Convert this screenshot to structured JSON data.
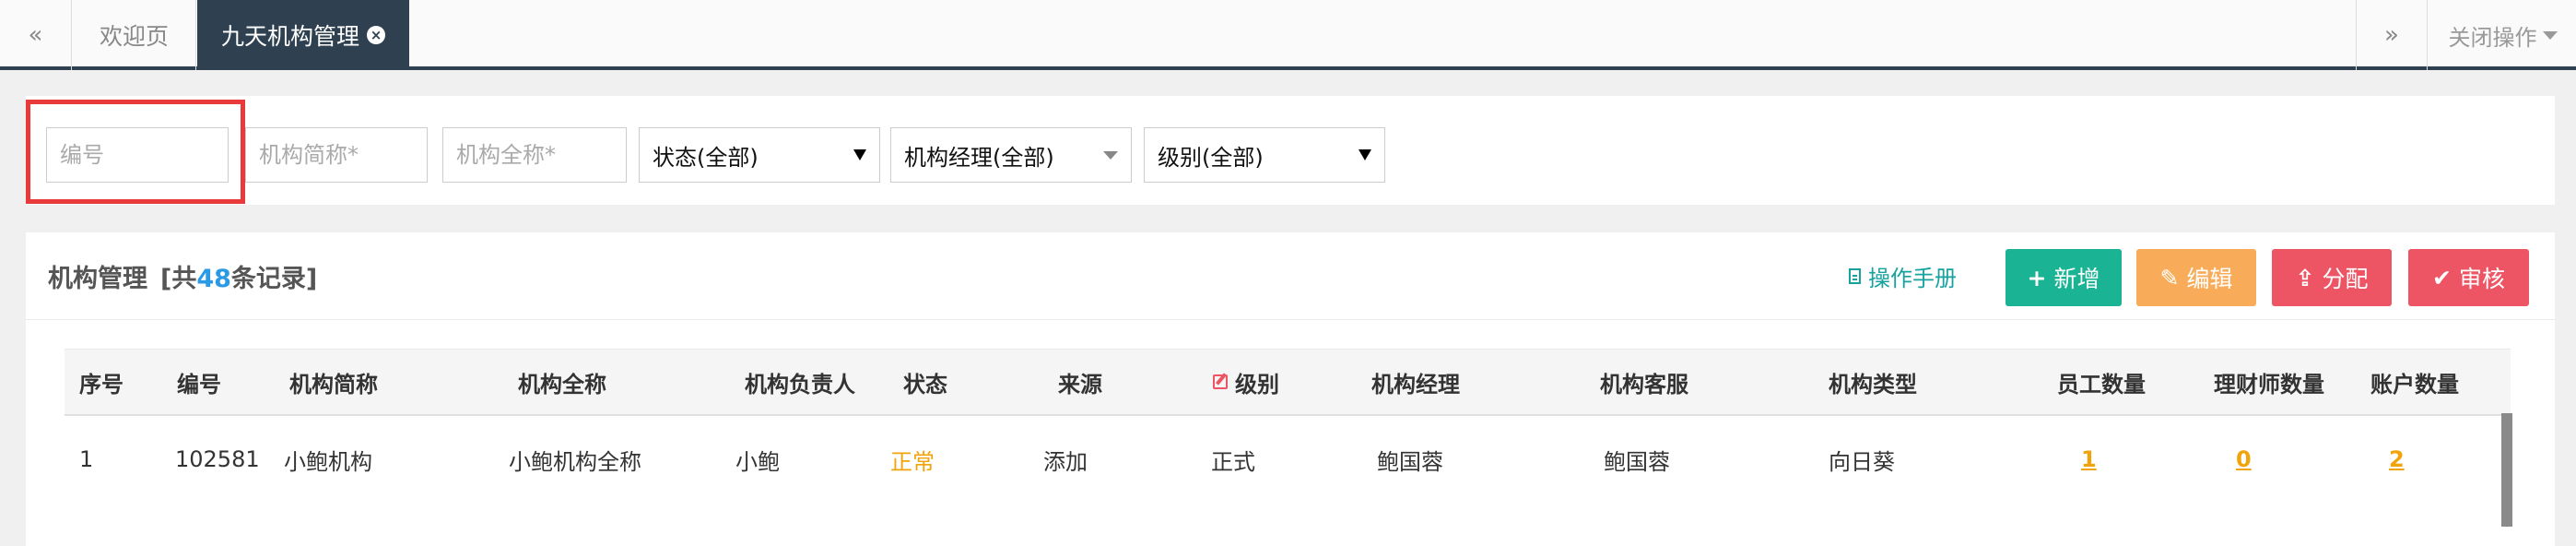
{
  "tabs": {
    "prev_icon": "«",
    "next_icon": "»",
    "welcome": "欢迎页",
    "active": "九天机构管理",
    "close_ops": "关闭操作"
  },
  "search": {
    "code_placeholder": "编号",
    "short_name_placeholder": "机构简称*",
    "full_name_placeholder": "机构全称*",
    "status_select": "状态(全部)",
    "manager_select": "机构经理(全部)",
    "level_select": "级别(全部)"
  },
  "panel": {
    "title": "机构管理",
    "count_prefix": "[共",
    "count": "48",
    "count_suffix": "条记录]",
    "manual": "操作手册",
    "buttons": {
      "add": "新增",
      "edit": "编辑",
      "assign": "分配",
      "audit": "审核"
    }
  },
  "table": {
    "columns": [
      "序号",
      "编号",
      "机构简称",
      "机构全称",
      "机构负责人",
      "状态",
      "来源",
      "级别",
      "机构经理",
      "机构客服",
      "机构类型",
      "员工数量",
      "理财师数量",
      "账户数量"
    ],
    "rows": [
      [
        "1",
        "102581",
        "小鲍机构",
        "小鲍机构全称",
        "小鲍",
        "正常",
        "添加",
        "正式",
        "鲍国蓉",
        "鲍国蓉",
        "向日葵",
        "1",
        "0",
        "2"
      ]
    ]
  },
  "colors": {
    "nav_dark": "#2f4050",
    "primary_green": "#1ab394",
    "warning_orange": "#f8ac59",
    "danger_red": "#ed5565",
    "count_blue": "#2a9ae5",
    "highlight_red": "#e83a3a"
  },
  "icons": {
    "add": "plus-icon",
    "edit": "edit-icon",
    "assign": "share-icon",
    "audit": "check-icon",
    "manual": "document-icon",
    "tab_close": "close-circle-icon"
  }
}
